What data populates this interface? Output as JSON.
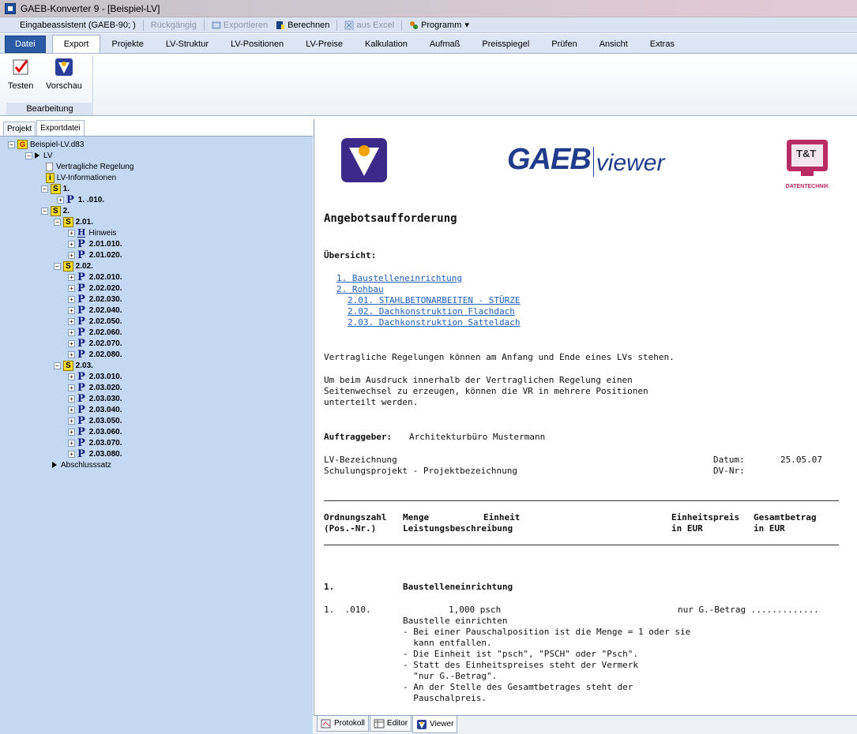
{
  "window": {
    "title": "GAEB-Konverter 9 - [Beispiel-LV]"
  },
  "quick_access": {
    "assistant": "Eingabeassistent (GAEB-90; )",
    "undo": "Rückgängig",
    "export": "Exportieren",
    "calculate": "Berechnen",
    "from_excel": "aus Excel",
    "program": "Programm",
    "dropdown": "▾"
  },
  "ribbon": {
    "tabs": [
      "Datei",
      "Export",
      "Projekte",
      "LV-Struktur",
      "LV-Positionen",
      "LV-Preise",
      "Kalkulation",
      "Aufmaß",
      "Preisspiegel",
      "Prüfen",
      "Ansicht",
      "Extras"
    ],
    "active_tab": "Export",
    "group_label": "Bearbeitung",
    "buttons": {
      "test": "Testen",
      "preview": "Vorschau"
    }
  },
  "left_tabs": {
    "project": "Projekt",
    "exportfile": "Exportdatei"
  },
  "tree": {
    "root": "Beispiel-LV.d83",
    "lv": "LV",
    "vertragliche": "Vertragliche Regelung",
    "lv_info": "LV-Informationen",
    "s1": "1.",
    "p1": "1.  .010.",
    "s2": "2.",
    "s201": "2.01.",
    "hinweis": "Hinweis",
    "p201010": "2.01.010.",
    "p201020": "2.01.020.",
    "s202": "2.02.",
    "p202": [
      "2.02.010.",
      "2.02.020.",
      "2.02.030.",
      "2.02.040.",
      "2.02.050.",
      "2.02.060.",
      "2.02.070.",
      "2.02.080."
    ],
    "s203": "2.03.",
    "p203": [
      "2.03.010.",
      "2.03.020.",
      "2.03.030.",
      "2.03.040.",
      "2.03.050.",
      "2.03.060.",
      "2.03.070.",
      "2.03.080."
    ],
    "abschluss": "Abschlusssatz",
    "letters": {
      "g": "G",
      "s": "S",
      "i": "i",
      "p": "P",
      "h": "H",
      "plus": "+",
      "minus": "−"
    }
  },
  "viewer": {
    "logo_gaeb": "GAEB",
    "logo_viewer": "viewer",
    "logo_tt": "T&T",
    "logo_tt_sub": "DATENTECHNIK",
    "heading": "Angebotsaufforderung",
    "overview": "Übersicht:",
    "links": [
      "1. Baustelleneinrichtung",
      "2. Rohbau",
      "2.01. STAHLBETONARBEITEN - STÜRZE",
      "2.02. Dachkonstruktion Flachdach",
      "2.03. Dachkonstruktion Satteldach"
    ],
    "para1": "Vertragliche Regelungen können am Anfang und Ende eines LVs stehen.",
    "para2": [
      "Um beim Ausdruck innerhalb der Vertraglichen Regelung einen",
      "Seitenwechsel zu erzeugen, können die VR in mehrere Positionen",
      "unterteilt werden."
    ],
    "client_label": "Auftraggeber:",
    "client_value": "Architekturbüro Mustermann",
    "lv_label": "LV-Bezeichnung",
    "lv_value": "Schulungsprojekt - Projektbezeichnung",
    "date_label": "Datum:",
    "date_value": "25.05.07",
    "dvnr_label": "DV-Nr:",
    "table_header": {
      "oz": "Ordnungszahl",
      "menge": "Menge",
      "einheit": "Einheit",
      "ep": "Einheitspreis",
      "gb": "Gesamtbetrag",
      "pos": "(Pos.-Nr.)",
      "lb": "Leistungsbeschreibung",
      "eur1": "in EUR",
      "eur2": "in EUR"
    },
    "section1_num": "1.",
    "section1_title": "Baustelleneinrichtung",
    "pos_num": "1.  .010.",
    "pos_qty": "1,000 psch",
    "pos_price": "nur G.-Betrag .............",
    "pos_text": [
      "Baustelle einrichten",
      "- Bei einer Pauschalposition ist die Menge = 1 oder sie",
      "  kann entfallen.",
      "- Die Einheit ist \"psch\", \"PSCH\" oder \"Psch\".",
      "- Statt des Einheitspreises steht der Vermerk",
      "  \"nur G.-Betrag\".",
      "- An der Stelle des Gesamtbetrages steht der",
      "  Pauschalpreis."
    ]
  },
  "bottom_tabs": {
    "protokoll": "Protokoll",
    "editor": "Editor",
    "viewer": "Viewer"
  }
}
